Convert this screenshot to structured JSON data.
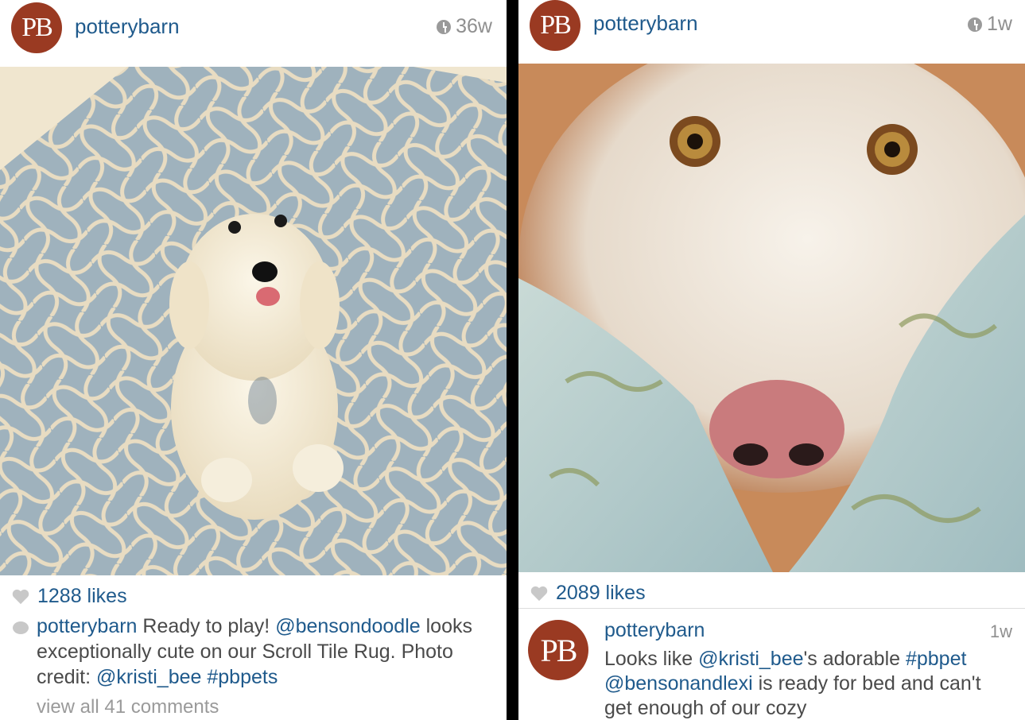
{
  "posts": [
    {
      "avatar_text": "PB",
      "username": "potterybarn",
      "time": "36w",
      "likes": "1288 likes",
      "caption": {
        "user": "potterybarn",
        "text1": " Ready to play! ",
        "mention1": "@bensondoodle",
        "text2": " looks exceptionally cute on our Scroll Tile Rug. Photo credit: ",
        "mention2": "@kristi_bee",
        "hashtag": "#pbpets"
      },
      "view_all": "view all 41 comments"
    },
    {
      "avatar_text": "PB",
      "username": "potterybarn",
      "time": "1w",
      "likes": "2089 likes",
      "comment": {
        "avatar_text": "PB",
        "user": "potterybarn",
        "time": "1w",
        "text1": "Looks like ",
        "mention1": "@kristi_bee",
        "text2": "'s adorable ",
        "hashtag": "#pbpet",
        "text3": " ",
        "mention2": "@bensonandlexi",
        "text4": " is ready for bed and can't get enough of our cozy"
      }
    }
  ],
  "colors": {
    "brand": "#9a3a22",
    "link": "#1f5a8c"
  }
}
